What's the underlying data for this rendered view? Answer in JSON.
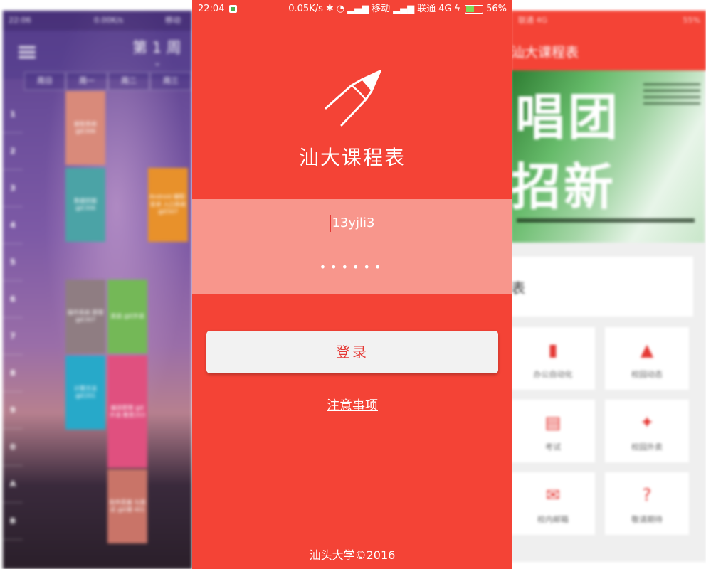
{
  "left_screen": {
    "status": {
      "time": "22:06",
      "speed": "0.00K/s",
      "carrier": "移动"
    },
    "week_label": "第 1 周",
    "days": [
      "周日",
      "周一",
      "周二",
      "周三"
    ],
    "periods": [
      "1",
      "2",
      "3",
      "4",
      "5",
      "6",
      "7",
      "8",
      "9",
      "0",
      "A",
      "B"
    ],
    "courses": [
      {
        "text": "嵌软系统 @E306",
        "color": "#d98a7a"
      },
      {
        "text": "数据挖掘 @E306",
        "color": "#4ba3a6"
      },
      {
        "text": "Android 编程·安卓 入口系统 @E507",
        "color": "#e8912b"
      },
      {
        "text": "操作系统 原理 @E307",
        "color": "#8f7d82"
      },
      {
        "text": "英语 @E外语",
        "color": "#74b857"
      },
      {
        "text": "计算方法 @E201",
        "color": "#27a9c9"
      },
      {
        "text": "编译原理 @E外语 教室203",
        "color": "#e0507f"
      },
      {
        "text": "软件质量 与测试 @E楼 401",
        "color": "#c97468"
      }
    ]
  },
  "login": {
    "status": {
      "time": "22:04",
      "speed": "0.05K/s",
      "carrier1": "移动",
      "carrier2": "联通",
      "network": "4G",
      "battery": "56%",
      "battery_level": 0.56
    },
    "app_title": "汕大课程表",
    "username_value": "13yjli3",
    "password_mask": "••••••",
    "login_button": "登录",
    "notice_link": "注意事项",
    "footer": "汕头大学©2016",
    "colors": {
      "primary": "#f44336",
      "panel": "#f8968c",
      "button": "#f2f2f2",
      "button_text": "#e53935"
    }
  },
  "right_screen": {
    "status": {
      "carrier": "联通",
      "network": "4G",
      "battery": "55%"
    },
    "toolbar_title": "汕大课程表",
    "banner_text_1": "唱团",
    "banner_text_2": "招新",
    "timetable_label": "表",
    "tiles": [
      {
        "label": "办公自动化",
        "icon": "document-icon"
      },
      {
        "label": "校园动态",
        "icon": "bell-icon"
      },
      {
        "label": "考试",
        "icon": "exam-icon"
      },
      {
        "label": "校园外卖",
        "icon": "delivery-icon"
      },
      {
        "label": "校内邮箱",
        "icon": "mail-icon"
      },
      {
        "label": "敬请期待",
        "icon": "question-icon"
      }
    ]
  }
}
